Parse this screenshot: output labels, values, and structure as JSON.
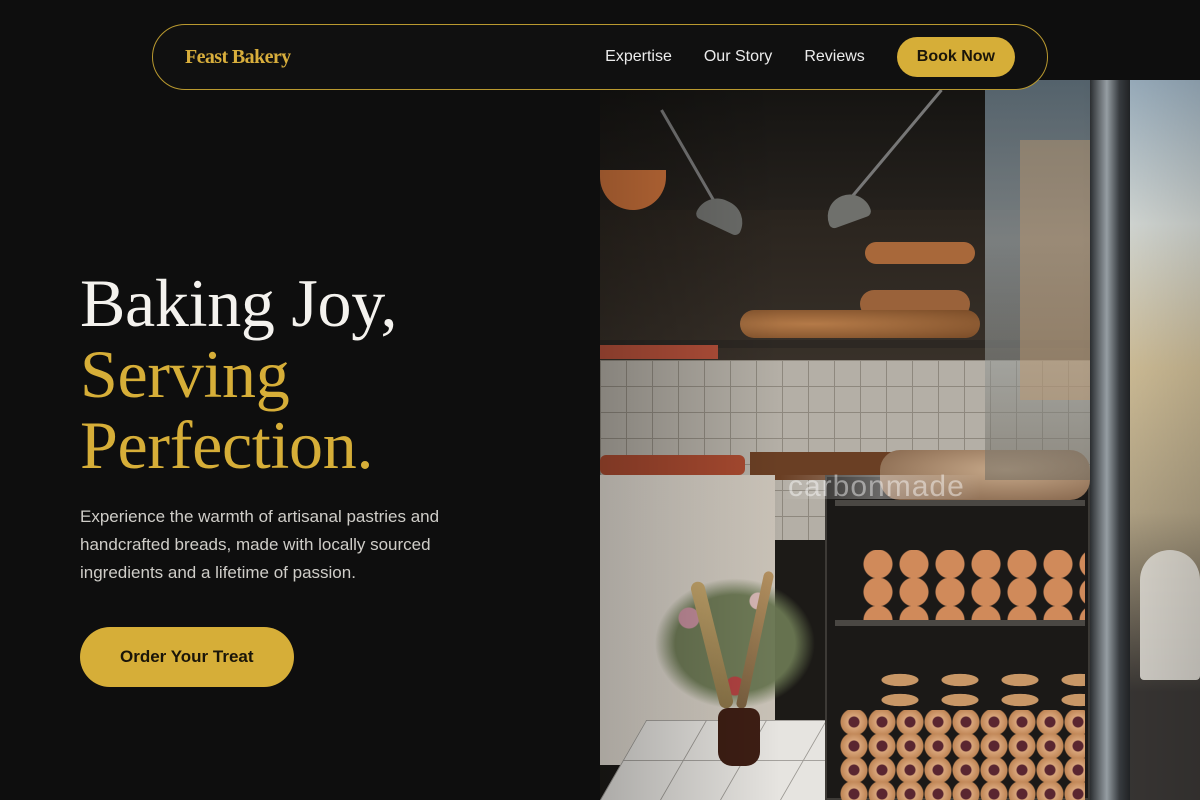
{
  "nav": {
    "brand": "Feast Bakery",
    "links": [
      "Expertise",
      "Our Story",
      "Reviews"
    ],
    "cta": "Book Now"
  },
  "hero": {
    "headline_line1": "Baking Joy,",
    "headline_line2": "Serving",
    "headline_line3": "Perfection.",
    "subtitle": "Experience the warmth of artisanal pastries and handcrafted breads, made with locally sourced ingredients and a lifetime of passion.",
    "cta": "Order Your Treat"
  },
  "photo": {
    "watermark": "carbonmade"
  },
  "colors": {
    "background": "#0e0e0e",
    "accent": "#d6ae38",
    "nav_border": "#b9992f",
    "heading_light": "#f4f2ee",
    "body_text": "#cfcdc8"
  }
}
